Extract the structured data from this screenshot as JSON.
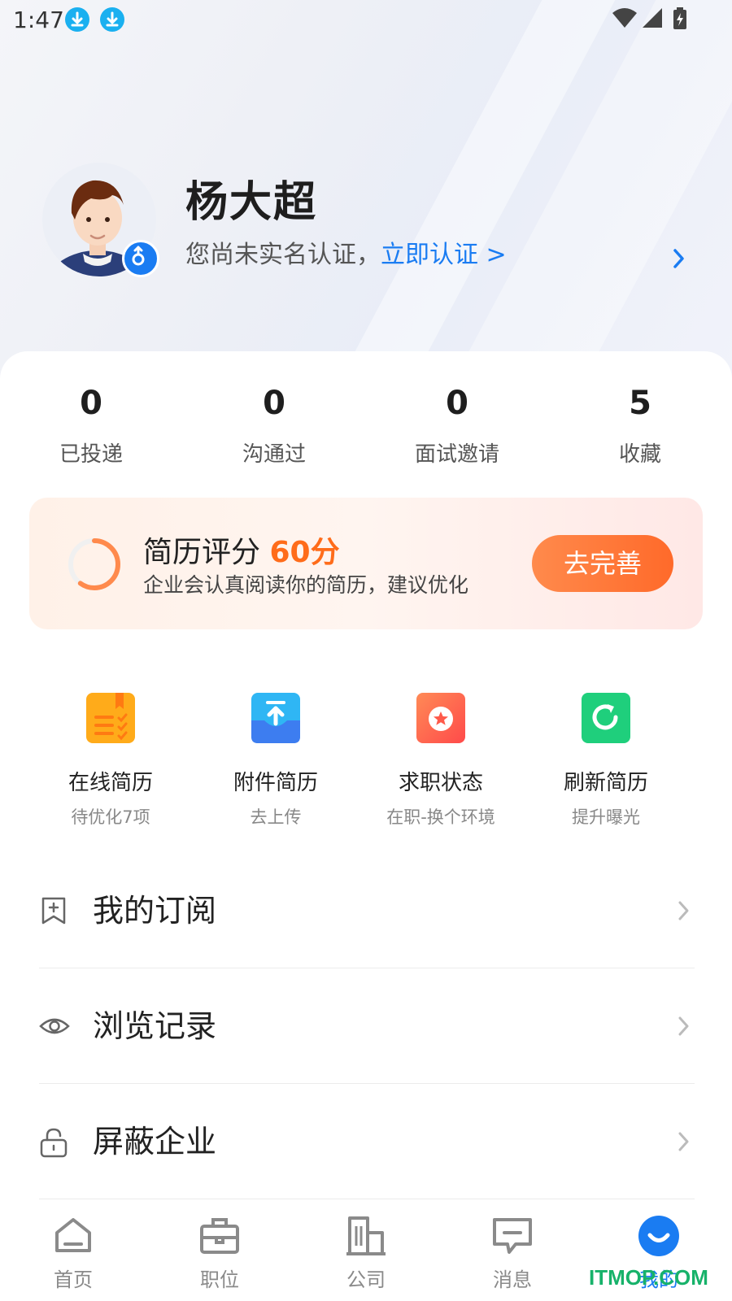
{
  "status_bar": {
    "time": "1:47"
  },
  "profile": {
    "name": "杨大超",
    "verify_text": "您尚未实名认证，",
    "verify_link": "立即认证 >"
  },
  "stats": [
    {
      "value": "0",
      "label": "已投递"
    },
    {
      "value": "0",
      "label": "沟通过"
    },
    {
      "value": "0",
      "label": "面试邀请"
    },
    {
      "value": "5",
      "label": "收藏"
    }
  ],
  "resume_score": {
    "title": "简历评分",
    "score": "60分",
    "score_fraction": 0.6,
    "description": "企业会认真阅读你的简历，建议优化",
    "button_label": "去完善",
    "colors": {
      "accent": "#ff6c1a"
    }
  },
  "shortcuts": [
    {
      "title": "在线简历",
      "subtitle": "待优化7项",
      "icon": "online-resume-icon"
    },
    {
      "title": "附件简历",
      "subtitle": "去上传",
      "icon": "upload-resume-icon"
    },
    {
      "title": "求职状态",
      "subtitle": "在职-换个环境",
      "icon": "job-status-icon"
    },
    {
      "title": "刷新简历",
      "subtitle": "提升曝光",
      "icon": "refresh-resume-icon"
    }
  ],
  "menu": [
    {
      "label": "我的订阅",
      "icon": "bookmark-icon"
    },
    {
      "label": "浏览记录",
      "icon": "eye-icon"
    },
    {
      "label": "屏蔽企业",
      "icon": "lock-icon"
    }
  ],
  "bottom_nav": [
    {
      "label": "首页",
      "icon": "home-icon"
    },
    {
      "label": "职位",
      "icon": "briefcase-icon"
    },
    {
      "label": "公司",
      "icon": "building-icon"
    },
    {
      "label": "消息",
      "icon": "message-icon"
    },
    {
      "label": "我的",
      "icon": "profile-smile-icon",
      "active": true
    }
  ],
  "watermark": "ITMOP.COM",
  "colors": {
    "brand": "#1a7cf2",
    "accent": "#ff6c1a"
  }
}
